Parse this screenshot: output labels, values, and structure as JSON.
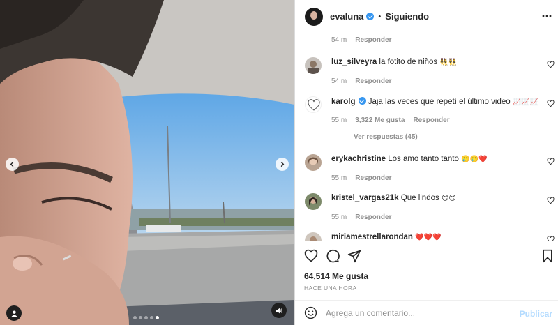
{
  "post": {
    "author": "evaluna",
    "follow_status": "Siguiendo",
    "separator": "•"
  },
  "media": {
    "slide_count": 5,
    "active_slide": 4,
    "prev_icon": "chevron-left-icon",
    "next_icon": "chevron-right-icon",
    "tag_icon": "user-tag-icon",
    "audio_icon": "speaker-icon"
  },
  "comments": {
    "top_meta": {
      "time": "54 m",
      "reply": "Responder"
    },
    "items": [
      {
        "user": "luz_silveyra",
        "verified": false,
        "text": "la fotito de niños",
        "emoji": "👯‍♀️👯‍♀️",
        "time": "54 m",
        "likes": "",
        "reply": "Responder"
      },
      {
        "user": "karolg",
        "verified": true,
        "text": "Jaja las veces que repetí el último video",
        "emoji": "📈📈📈",
        "time": "55 m",
        "likes": "3,322 Me gusta",
        "reply": "Responder"
      },
      {
        "user": "erykachristine",
        "verified": false,
        "text": "Los amo tanto tanto",
        "emoji": "🥲🥲❤️",
        "time": "55 m",
        "likes": "",
        "reply": "Responder"
      },
      {
        "user": "kristel_vargas21k",
        "verified": false,
        "text": "Que lindos",
        "emoji": "😍😍",
        "time": "55 m",
        "likes": "",
        "reply": "Responder"
      },
      {
        "user": "miriamestrellarondan",
        "verified": false,
        "text": "",
        "emoji": "❤️❤️❤️",
        "time": "",
        "likes": "",
        "reply": ""
      }
    ],
    "view_replies": "Ver respuestas (45)"
  },
  "actions": {
    "like_icon": "heart-icon",
    "comment_icon": "comment-icon",
    "share_icon": "share-icon",
    "save_icon": "bookmark-icon",
    "likes_count": "64,514 Me gusta",
    "posted_time": "HACE UNA HORA"
  },
  "composer": {
    "placeholder": "Agrega un comentario...",
    "publish_label": "Publicar",
    "emoji_icon": "smiley-icon"
  },
  "colors": {
    "verified": "#3897f0",
    "publish_disabled": "#b3dbff",
    "secondary_text": "#8e8e8e"
  }
}
